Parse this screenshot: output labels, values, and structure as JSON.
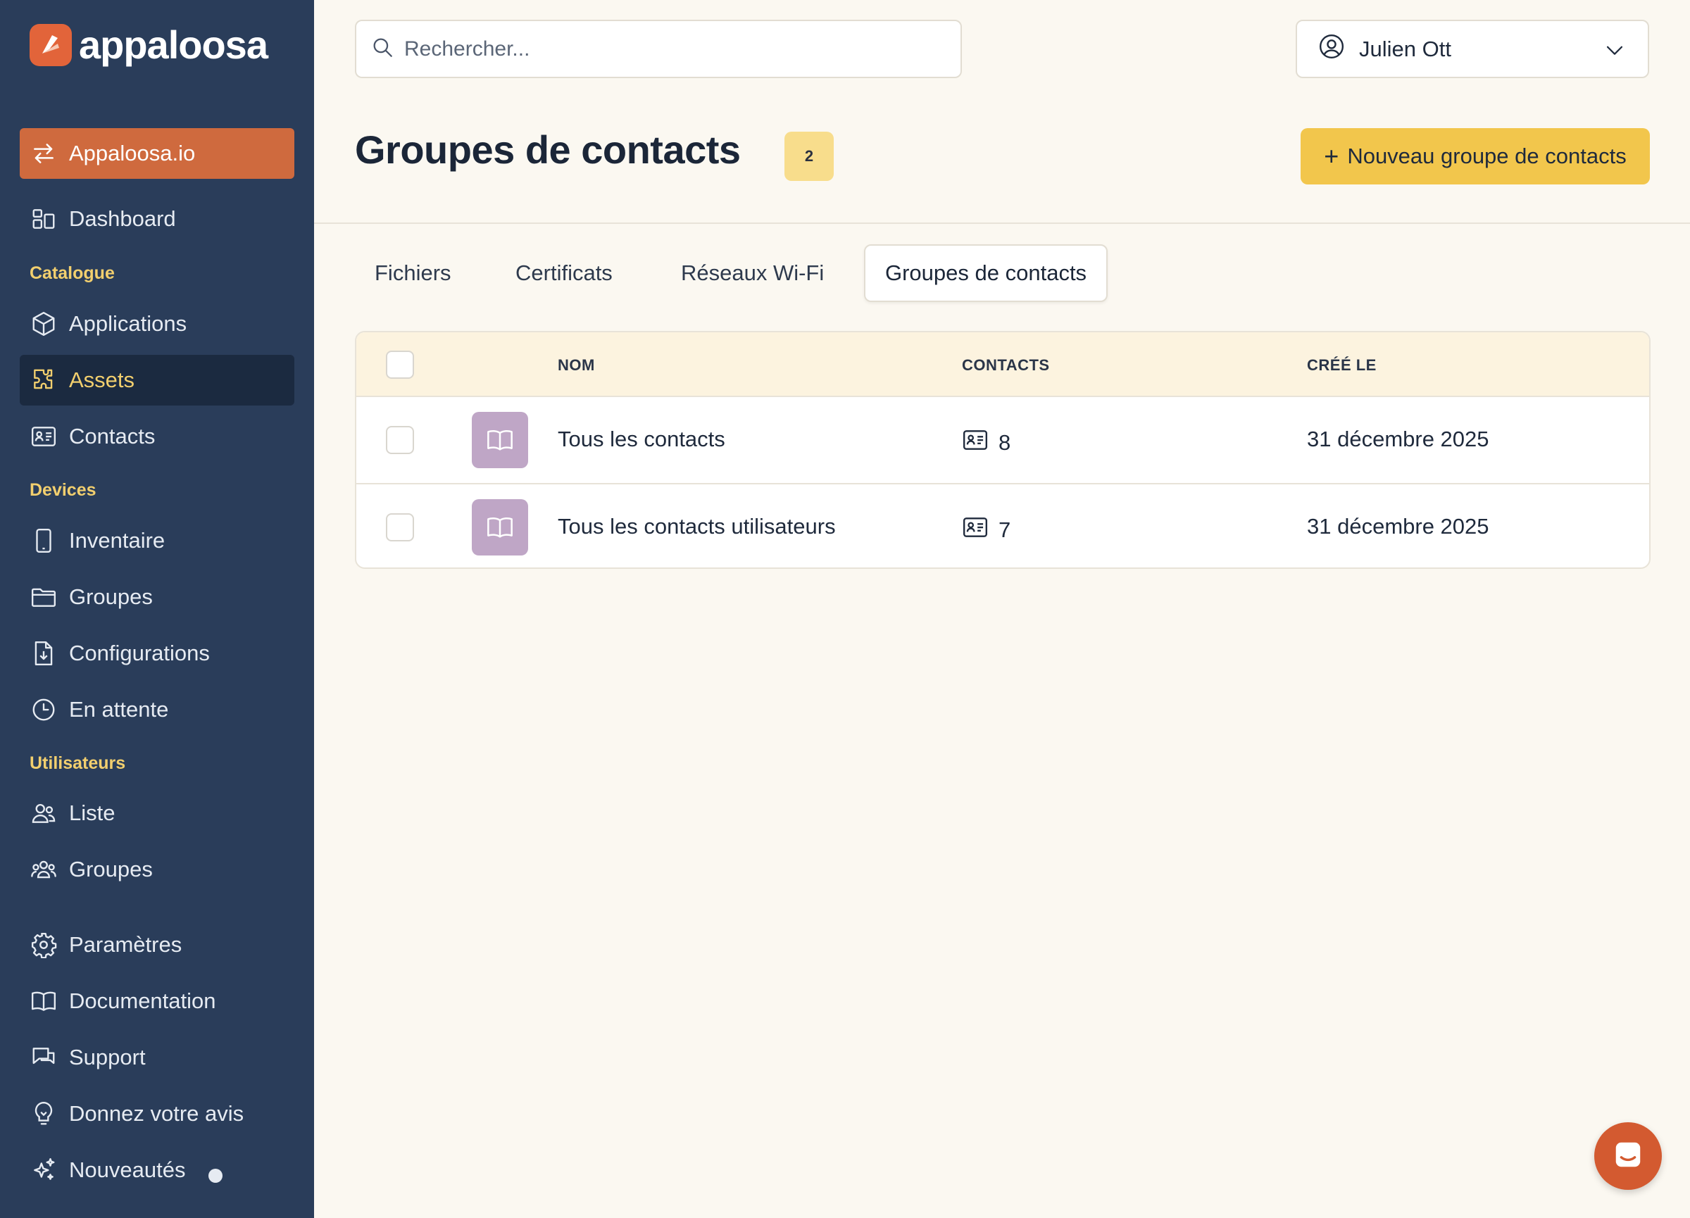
{
  "app": {
    "logo_text": "appaloosa"
  },
  "sidebar": {
    "org_switch": "Appaloosa.io",
    "dashboard": "Dashboard",
    "sections": {
      "catalogue": "Catalogue",
      "devices": "Devices",
      "users": "Utilisateurs"
    },
    "catalogue_items": [
      "Applications",
      "Assets",
      "Contacts"
    ],
    "devices_items": [
      "Inventaire",
      "Groupes",
      "Configurations",
      "En attente"
    ],
    "users_items": [
      "Liste",
      "Groupes"
    ],
    "footer_items": [
      "Paramètres",
      "Documentation",
      "Support",
      "Donnez votre avis",
      "Nouveautés"
    ],
    "active_item": "Assets"
  },
  "header": {
    "search_placeholder": "Rechercher...",
    "user_name": "Julien Ott"
  },
  "page": {
    "title": "Groupes de contacts",
    "count": "2",
    "new_button": "Nouveau groupe de contacts",
    "new_button_icon": "+"
  },
  "tabs": [
    {
      "label": "Fichiers",
      "active": false
    },
    {
      "label": "Certificats",
      "active": false
    },
    {
      "label": "Réseaux Wi-Fi",
      "active": false
    },
    {
      "label": "Groupes de contacts",
      "active": true
    }
  ],
  "table": {
    "columns": {
      "name": "NOM",
      "contacts": "CONTACTS",
      "created": "CRÉÉ LE"
    },
    "rows": [
      {
        "name": "Tous les contacts",
        "contacts": "8",
        "created": "31 décembre 2025"
      },
      {
        "name": "Tous les contacts utilisateurs",
        "contacts": "7",
        "created": "31 décembre 2025"
      }
    ]
  },
  "colors": {
    "sidebar_bg": "#2a3d5a",
    "accent_orange": "#cf6a3e",
    "accent_yellow": "#f2c64c",
    "section_label": "#f2cf6e",
    "row_icon_bg": "#bfa6c6"
  }
}
